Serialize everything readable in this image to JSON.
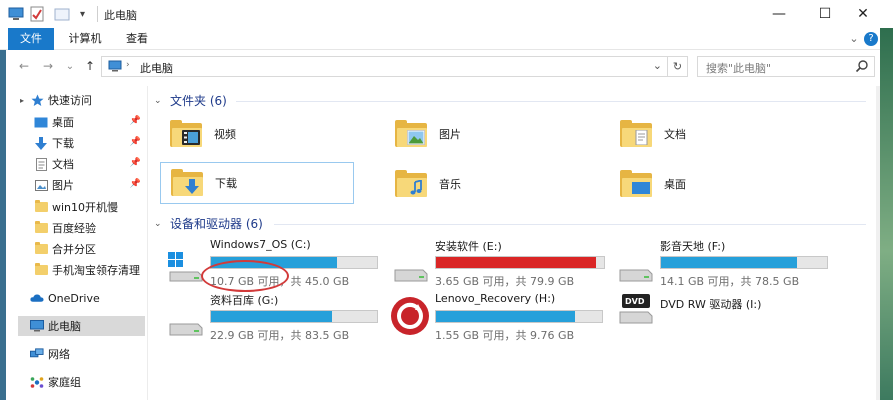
{
  "window": {
    "title": "此电脑",
    "minimize_glyph": "—",
    "maximize_glyph": "☐",
    "close_glyph": "✕",
    "dropdown_glyph": "▾"
  },
  "ribbon": {
    "tabs": [
      {
        "label": "文件",
        "active": true
      },
      {
        "label": "计算机",
        "active": false
      },
      {
        "label": "查看",
        "active": false
      }
    ],
    "collapse_glyph": "⌄",
    "help_glyph": "?"
  },
  "address": {
    "path": "此电脑",
    "refresh_glyph": "↻",
    "dropdown_glyph": "⌄",
    "search_placeholder": "搜索\"此电脑\""
  },
  "nav_glyphs": {
    "back": "←",
    "forward": "→",
    "recent": "⌄",
    "up": "↑"
  },
  "sidebar": {
    "quick_access": "快速访问",
    "pinned": [
      {
        "label": "桌面",
        "icon": "desktop-icon"
      },
      {
        "label": "下载",
        "icon": "download-icon"
      },
      {
        "label": "文档",
        "icon": "document-icon"
      },
      {
        "label": "图片",
        "icon": "picture-icon"
      }
    ],
    "folders": [
      {
        "label": "win10开机慢"
      },
      {
        "label": "百度经验"
      },
      {
        "label": "合并分区"
      },
      {
        "label": "手机淘宝领存清理"
      }
    ],
    "onedrive": "OneDrive",
    "this_pc": "此电脑",
    "network": "网络",
    "homegroup": "家庭组"
  },
  "folders_group": {
    "title": "文件夹 (6)",
    "items": [
      {
        "label": "视频",
        "icon": "video-folder-icon"
      },
      {
        "label": "图片",
        "icon": "pictures-folder-icon"
      },
      {
        "label": "文档",
        "icon": "documents-folder-icon"
      },
      {
        "label": "下载",
        "icon": "downloads-folder-icon"
      },
      {
        "label": "音乐",
        "icon": "music-folder-icon"
      },
      {
        "label": "桌面",
        "icon": "desktop-folder-icon"
      }
    ]
  },
  "devices_group": {
    "title": "设备和驱动器 (6)",
    "drives": [
      {
        "name": "Windows7_OS (C:)",
        "free": "10.7 GB 可用，共 45.0 GB",
        "used_fraction": 0.76,
        "fill_color": "#26a0da",
        "icon": "windows-drive-icon"
      },
      {
        "name": "安装软件 (E:)",
        "free": "3.65 GB 可用，共 79.9 GB",
        "used_fraction": 0.95,
        "fill_color": "#da2626",
        "icon": "hard-drive-icon"
      },
      {
        "name": "影音天地 (F:)",
        "free": "14.1 GB 可用，共 78.5 GB",
        "used_fraction": 0.82,
        "fill_color": "#26a0da",
        "icon": "hard-drive-icon"
      },
      {
        "name": "资料百库 (G:)",
        "free": "22.9 GB 可用，共 83.5 GB",
        "used_fraction": 0.73,
        "fill_color": "#26a0da",
        "icon": "hard-drive-icon"
      },
      {
        "name": "Lenovo_Recovery (H:)",
        "free": "1.55 GB 可用，共 9.76 GB",
        "used_fraction": 0.84,
        "fill_color": "#26a0da",
        "icon": "recovery-drive-icon"
      },
      {
        "name": "DVD RW 驱动器 (I:)",
        "icon": "dvd-drive-icon",
        "badge": "DVD"
      }
    ]
  },
  "colors": {
    "accent": "#1979ca",
    "drive_blue": "#26a0da",
    "drive_red": "#da2626",
    "annotation": "#d23a3a"
  }
}
